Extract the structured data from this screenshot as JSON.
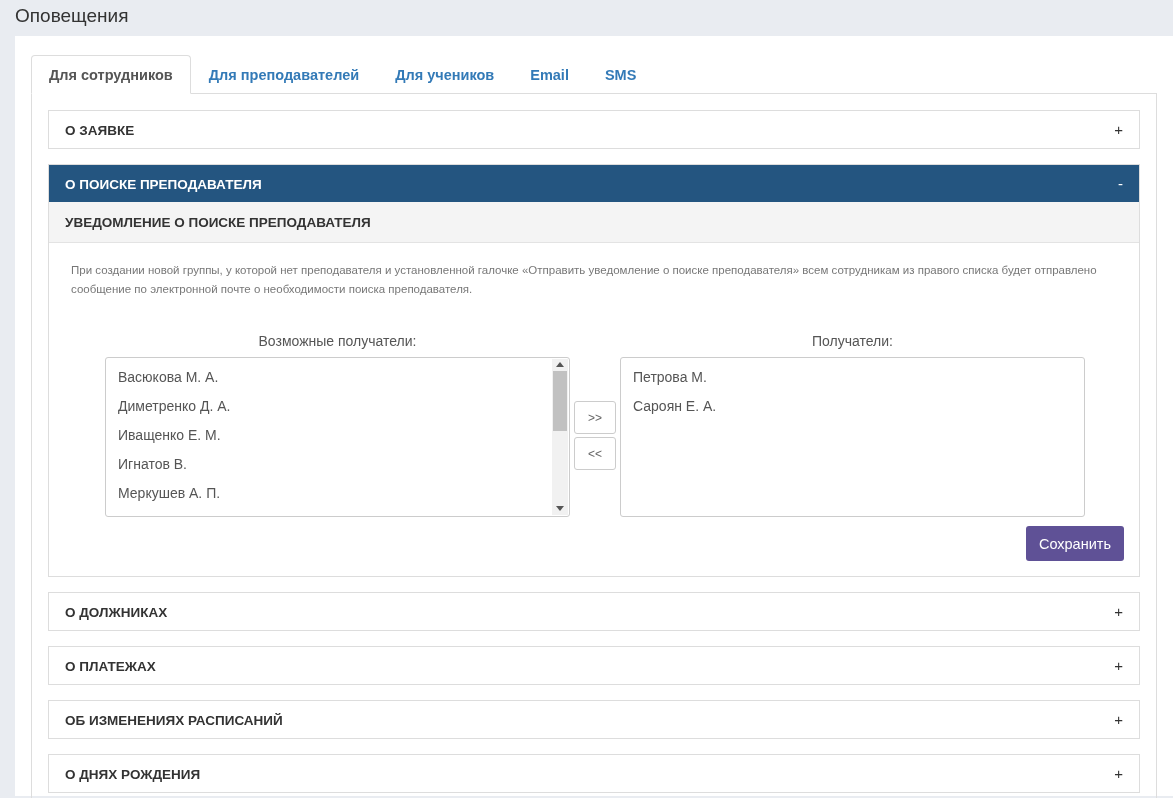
{
  "page": {
    "title": "Оповещения"
  },
  "tabs": [
    {
      "label": "Для сотрудников",
      "selected": true
    },
    {
      "label": "Для преподавателей",
      "selected": false
    },
    {
      "label": "Для учеников",
      "selected": false
    },
    {
      "label": "Email",
      "selected": false
    },
    {
      "label": "SMS",
      "selected": false
    }
  ],
  "sections": [
    {
      "title": "О ЗАЯВКЕ",
      "toggle": "+",
      "expanded": false
    },
    {
      "title": "О ПОИСКЕ ПРЕПОДАВАТЕЛЯ",
      "toggle": "-",
      "expanded": true,
      "content": {
        "subtitle": "УВЕДОМЛЕНИЕ О ПОИСКЕ ПРЕПОДАВАТЕЛЯ",
        "description": "При создании новой группы, у которой нет преподавателя и установленной галочке «Отправить уведомление о поиске преподавателя» всем сотрудникам из правого списка будет отправлено сообщение по электронной почте о необходимости поиска преподавателя.",
        "available_label": "Возможные получатели:",
        "available": [
          "Васюкова М. А.",
          "Диметренко Д. А.",
          "Иващенко Е. М.",
          "Игнатов В.",
          "Меркушев А. П."
        ],
        "recipients_label": "Получатели:",
        "recipients": [
          "Петрова М.",
          "Сароян Е. А."
        ],
        "move_right": ">>",
        "move_left": "<<",
        "save": "Сохранить"
      }
    },
    {
      "title": "О ДОЛЖНИКАХ",
      "toggle": "+",
      "expanded": false
    },
    {
      "title": "О ПЛАТЕЖАХ",
      "toggle": "+",
      "expanded": false
    },
    {
      "title": "ОБ ИЗМЕНЕНИЯХ РАСПИСАНИЙ",
      "toggle": "+",
      "expanded": false
    },
    {
      "title": "О ДНЯХ РОЖДЕНИЯ",
      "toggle": "+",
      "expanded": false
    }
  ]
}
